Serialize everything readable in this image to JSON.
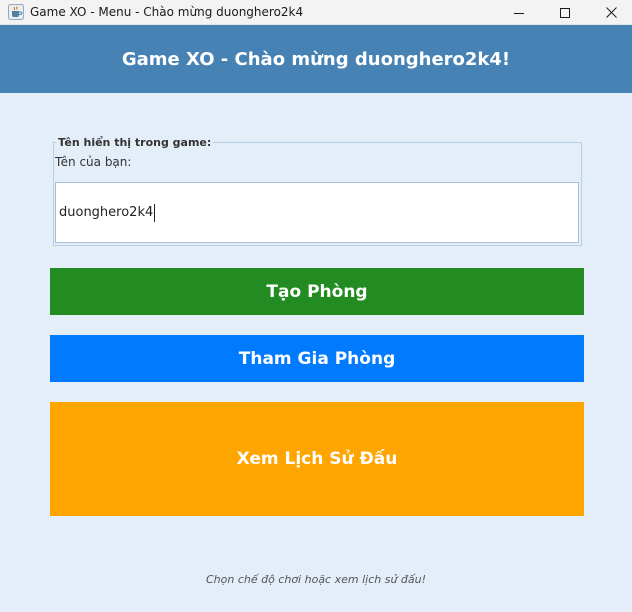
{
  "window": {
    "title": "Game XO - Menu - Chào mừng duonghero2k4",
    "app_icon": "java-cup-icon",
    "controls": [
      "minimize-icon",
      "maximize-icon",
      "close-icon"
    ]
  },
  "header": {
    "title": "Game XO - Chào mừng duonghero2k4!",
    "background": "#4682b4"
  },
  "name_group": {
    "legend": "Tên hiển thị trong game:",
    "label": "Tên của bạn:",
    "input_value": "duonghero2k4"
  },
  "buttons": {
    "create_room": {
      "label": "Tạo Phòng",
      "color": "#228b22"
    },
    "join_room": {
      "label": "Tham Gia Phòng",
      "color": "#007bff"
    },
    "match_history": {
      "label": "Xem Lịch Sử Đấu",
      "color": "#ffa500"
    }
  },
  "footer": {
    "hint": "Chọn chế độ chơi hoặc xem lịch sử đấu!"
  }
}
